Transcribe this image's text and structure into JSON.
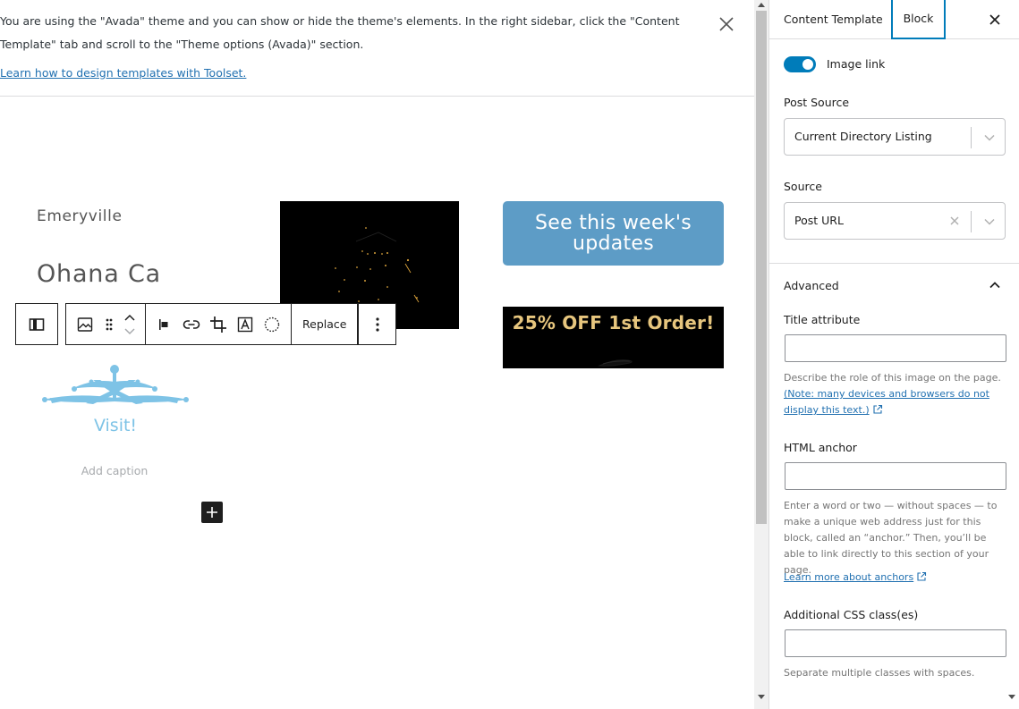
{
  "notice": {
    "text": "You are using the \"Avada\" theme and you can show or hide the theme's elements. In the right sidebar, click the \"Content Template\" tab and scroll to the \"Theme options (Avada)\" section.",
    "link": "Learn how to design templates with Toolset."
  },
  "content": {
    "location": "Emeryville",
    "restaurant": "Ohana Ca",
    "updates_button": "See this week's updates",
    "promo_text": "25% OFF 1st Order!",
    "logo_text": "Visit!",
    "caption_placeholder": "Add caption"
  },
  "toolbar": {
    "replace_label": "Replace"
  },
  "sidebar": {
    "tabs": [
      {
        "label": "Content Template"
      },
      {
        "label": "Block"
      }
    ],
    "image_link": {
      "label": "Image link",
      "checked": true
    },
    "post_source": {
      "label": "Post Source",
      "value": "Current Directory Listing"
    },
    "source": {
      "label": "Source",
      "value": "Post URL"
    },
    "advanced": {
      "label": "Advanced",
      "expanded": true,
      "title_attribute": {
        "label": "Title attribute",
        "value": "",
        "help": "Describe the role of this image on the page.",
        "help_link": "(Note: many devices and browsers do not display this text.)"
      },
      "html_anchor": {
        "label": "HTML anchor",
        "value": "",
        "help": "Enter a word or two — without spaces — to make a unique web address just for this block, called an “anchor.” Then, you’ll be able to link directly to this section of your page.",
        "help_link": "Learn more about anchors"
      },
      "css_classes": {
        "label": "Additional CSS class(es)",
        "value": "",
        "help": "Separate multiple classes with spaces."
      }
    }
  },
  "colors": {
    "accent": "#007cba",
    "button_blue": "#5d9cc6",
    "promo_gold": "#e7c67e",
    "logo_blue": "#7ec3e6"
  }
}
